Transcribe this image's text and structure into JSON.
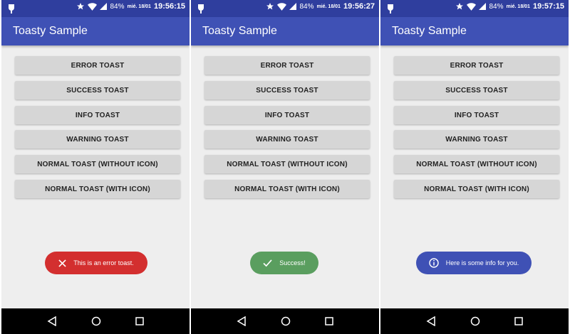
{
  "colors": {
    "primary": "#3f51b5",
    "status_bar": "#2f3e9e",
    "error": "#d32f2f",
    "success": "#5a9e5f",
    "info": "#3f51b5"
  },
  "app": {
    "title": "Toasty Sample"
  },
  "buttons": {
    "error": "ERROR TOAST",
    "success": "SUCCESS TOAST",
    "info": "INFO TOAST",
    "warning": "WARNING TOAST",
    "normal_without_icon": "NORMAL TOAST (WITHOUT ICON)",
    "normal_with_icon": "NORMAL TOAST (WITH ICON)"
  },
  "screens": [
    {
      "battery": "84%",
      "date": "mié. 18/01",
      "time": "19:56:15",
      "toast": {
        "type": "error",
        "icon": "close-icon",
        "text": "This is an error toast."
      }
    },
    {
      "battery": "84%",
      "date": "mié. 18/01",
      "time": "19:56:27",
      "toast": {
        "type": "success",
        "icon": "check-icon",
        "text": "Success!"
      }
    },
    {
      "battery": "84%",
      "date": "mié. 18/01",
      "time": "19:57:15",
      "toast": {
        "type": "info",
        "icon": "info-icon",
        "text": "Here is some info for you."
      }
    }
  ],
  "nav": {
    "back": "back-icon",
    "home": "home-icon",
    "recents": "recents-icon"
  }
}
